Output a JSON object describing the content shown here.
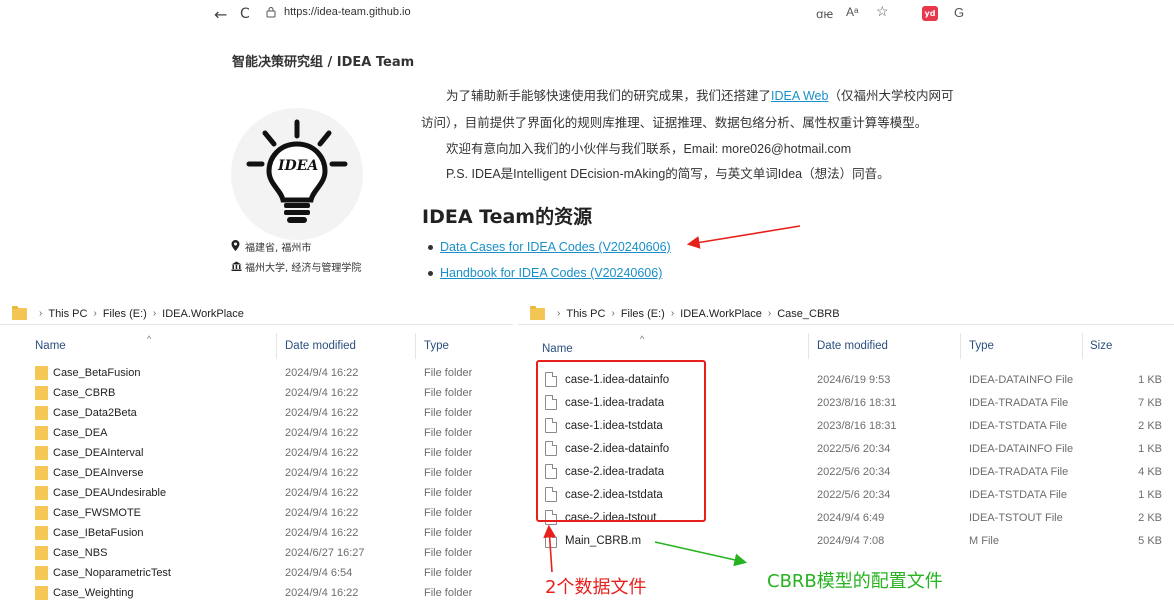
{
  "browser": {
    "back": "←",
    "reload": "C",
    "url": "https://idea-team.github.io",
    "read_aloud": "ꭤꭡ",
    "font_a": "Aᵃ",
    "favorite": "☆",
    "ext_badge": "yd",
    "copilot": "G"
  },
  "site": {
    "title": "智能决策研究组 / IDEA Team",
    "logo_text": "IDEA",
    "location": "福建省, 福州市",
    "organization": "福州大学, 经济与管理学院",
    "intro_1_before": "为了辅助新手能够快速使用我们的研究成果，我们还搭建了",
    "intro_1_link": "IDEA Web",
    "intro_1_after": "（仅福州大学校内网可",
    "intro_2": "访问），目前提供了界面化的规则库推理、证据推理、数据包络分析、属性权重计算等模型。",
    "intro_3": "欢迎有意向加入我们的小伙伴与我们联系，Email: more026@hotmail.com",
    "intro_4": "P.S. IDEA是Intelligent DEcision-mAking的简写，与英文单词Idea（想法）同音。",
    "resources_heading": "IDEA Team的资源",
    "resources": [
      "Data Cases for IDEA Codes (V20240606)",
      "Handbook for IDEA Codes (V20240606)"
    ]
  },
  "explorer_left": {
    "breadcrumb": [
      "This PC",
      "Files (E:)",
      "IDEA.WorkPlace"
    ],
    "columns": [
      "Name",
      "Date modified",
      "Type"
    ],
    "rows": [
      {
        "name": "Case_BetaFusion",
        "date": "2024/9/4 16:22",
        "type": "File folder"
      },
      {
        "name": "Case_CBRB",
        "date": "2024/9/4 16:22",
        "type": "File folder"
      },
      {
        "name": "Case_Data2Beta",
        "date": "2024/9/4 16:22",
        "type": "File folder"
      },
      {
        "name": "Case_DEA",
        "date": "2024/9/4 16:22",
        "type": "File folder"
      },
      {
        "name": "Case_DEAInterval",
        "date": "2024/9/4 16:22",
        "type": "File folder"
      },
      {
        "name": "Case_DEAInverse",
        "date": "2024/9/4 16:22",
        "type": "File folder"
      },
      {
        "name": "Case_DEAUndesirable",
        "date": "2024/9/4 16:22",
        "type": "File folder"
      },
      {
        "name": "Case_FWSMOTE",
        "date": "2024/9/4 16:22",
        "type": "File folder"
      },
      {
        "name": "Case_IBetaFusion",
        "date": "2024/9/4 16:22",
        "type": "File folder"
      },
      {
        "name": "Case_NBS",
        "date": "2024/6/27 16:27",
        "type": "File folder"
      },
      {
        "name": "Case_NoparametricTest",
        "date": "2024/9/4 6:54",
        "type": "File folder"
      },
      {
        "name": "Case_Weighting",
        "date": "2024/9/4 16:22",
        "type": "File folder"
      }
    ]
  },
  "explorer_right": {
    "breadcrumb": [
      "This PC",
      "Files (E:)",
      "IDEA.WorkPlace",
      "Case_CBRB"
    ],
    "columns": [
      "Name",
      "Date modified",
      "Type",
      "Size"
    ],
    "rows": [
      {
        "name": "case-1.idea-datainfo",
        "date": "2024/6/19 9:53",
        "type": "IDEA-DATAINFO File",
        "size": "1 KB"
      },
      {
        "name": "case-1.idea-tradata",
        "date": "2023/8/16 18:31",
        "type": "IDEA-TRADATA File",
        "size": "7 KB"
      },
      {
        "name": "case-1.idea-tstdata",
        "date": "2023/8/16 18:31",
        "type": "IDEA-TSTDATA File",
        "size": "2 KB"
      },
      {
        "name": "case-2.idea-datainfo",
        "date": "2022/5/6 20:34",
        "type": "IDEA-DATAINFO File",
        "size": "1 KB"
      },
      {
        "name": "case-2.idea-tradata",
        "date": "2022/5/6 20:34",
        "type": "IDEA-TRADATA File",
        "size": "4 KB"
      },
      {
        "name": "case-2.idea-tstdata",
        "date": "2022/5/6 20:34",
        "type": "IDEA-TSTDATA File",
        "size": "1 KB"
      },
      {
        "name": "case-2.idea-tstout",
        "date": "2024/9/4 6:49",
        "type": "IDEA-TSTOUT File",
        "size": "2 KB"
      },
      {
        "name": "Main_CBRB.m",
        "date": "2024/9/4 7:08",
        "type": "M File",
        "size": "5 KB"
      }
    ]
  },
  "annotations": {
    "data_files": "2个数据文件",
    "config_file": "CBRB模型的配置文件",
    "red": "#e8201c",
    "green": "#26b31f"
  }
}
